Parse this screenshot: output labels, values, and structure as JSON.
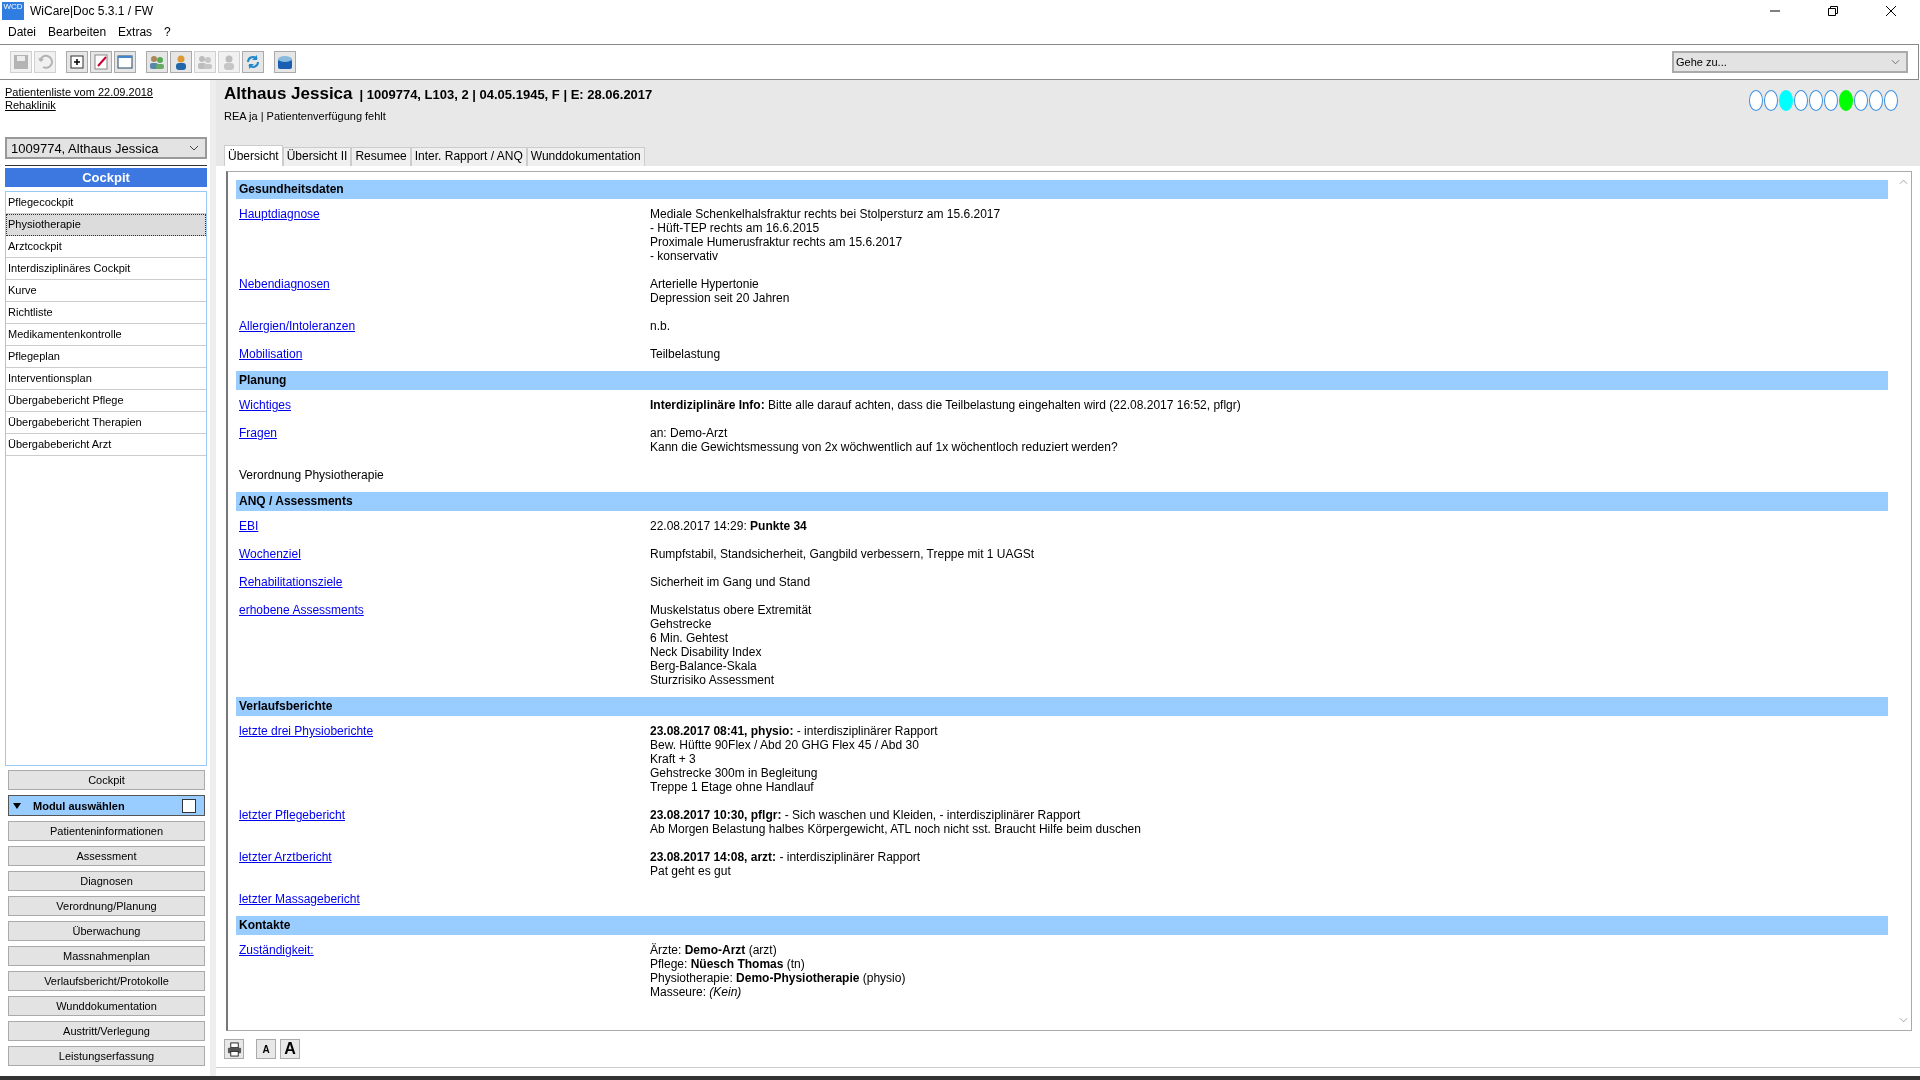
{
  "window": {
    "title": "WiCare|Doc 5.3.1  / FW",
    "logo_text": "WCD"
  },
  "menu": [
    "Datei",
    "Bearbeiten",
    "Extras",
    "?"
  ],
  "toolbar": [
    {
      "kind": "save",
      "disabled": true
    },
    {
      "kind": "undo",
      "disabled": true
    },
    {
      "kind": "sep"
    },
    {
      "kind": "add",
      "disabled": false
    },
    {
      "kind": "edit",
      "disabled": false
    },
    {
      "kind": "window",
      "disabled": false
    },
    {
      "kind": "sep"
    },
    {
      "kind": "group",
      "disabled": false
    },
    {
      "kind": "person",
      "disabled": false
    },
    {
      "kind": "group",
      "disabled": true
    },
    {
      "kind": "person",
      "disabled": true
    },
    {
      "kind": "refresh",
      "disabled": false
    },
    {
      "kind": "sep"
    },
    {
      "kind": "box",
      "disabled": false
    }
  ],
  "goto": {
    "value": "Gehe zu..."
  },
  "sidebar": {
    "patient_list_link": "Patientenliste vom 22.09.2018",
    "clinic_link": "Rehaklinik",
    "patient_select": "1009774, Althaus Jessica",
    "cockpit_title": "Cockpit",
    "items": [
      {
        "label": "Pflegecockpit",
        "selected": false
      },
      {
        "label": "Physiotherapie",
        "selected": true
      },
      {
        "label": "Arztcockpit",
        "selected": false
      },
      {
        "label": "Interdisziplinäres Cockpit",
        "selected": false
      },
      {
        "label": "Kurve",
        "selected": false
      },
      {
        "label": "Richtliste",
        "selected": false
      },
      {
        "label": "Medikamentenkontrolle",
        "selected": false
      },
      {
        "label": "Pflegeplan",
        "selected": false
      },
      {
        "label": "Interventionsplan",
        "selected": false
      },
      {
        "label": "Übergabebericht Pflege",
        "selected": false
      },
      {
        "label": "Übergabebericht Therapien",
        "selected": false
      },
      {
        "label": "Übergabebericht Arzt",
        "selected": false
      }
    ],
    "cockpit_button": "Cockpit",
    "module_header": {
      "label": "Modul auswählen",
      "expanded": true,
      "checked": false
    },
    "modules": [
      "Patienteninformationen",
      "Assessment",
      "Diagnosen",
      "Verordnung/Planung",
      "Überwachung",
      "Massnahmenplan",
      "Verlaufsbericht/Protokolle",
      "Wunddokumentation",
      "Austritt/Verlegung",
      "Leistungserfassung"
    ]
  },
  "patient": {
    "name": "Althaus Jessica",
    "details": "| 1009774, L103, 2 | 04.05.1945, F | E: 28.06.2017",
    "subline": "REA ja | Patientenverfügung fehlt",
    "status_dots": [
      {
        "color": "#ffffff"
      },
      {
        "color": "#ffffff"
      },
      {
        "color": "#00ffff"
      },
      {
        "color": "#ffffff"
      },
      {
        "color": "#ffffff"
      },
      {
        "color": "#ffffff"
      },
      {
        "color": "#00ff00"
      },
      {
        "color": "#ffffff"
      },
      {
        "color": "#ffffff"
      },
      {
        "color": "#ffffff"
      }
    ]
  },
  "tabs": [
    {
      "label": "Übersicht",
      "selected": true
    },
    {
      "label": "Übersicht II",
      "selected": false
    },
    {
      "label": "Resumee",
      "selected": false
    },
    {
      "label": "Inter. Rapport / ANQ",
      "selected": false
    },
    {
      "label": "Wunddokumentation",
      "selected": false
    }
  ],
  "sections": [
    {
      "title": "Gesundheitsdaten",
      "rows": [
        {
          "kind": "link",
          "label": "Hauptdiagnose",
          "lines": [
            "Mediale Schenkelhalsfraktur rechts bei Stolpersturz am 15.6.2017",
            "- Hüft-TEP rechts am 16.6.2015",
            "Proximale Humerusfraktur rechts am 15.6.2017",
            "- konservativ"
          ]
        },
        {
          "kind": "link",
          "label": "Nebendiagnosen",
          "lines": [
            "Arterielle Hypertonie",
            "Depression seit 20 Jahren"
          ]
        },
        {
          "kind": "link",
          "label": "Allergien/Intoleranzen",
          "lines": [
            "n.b."
          ]
        },
        {
          "kind": "link",
          "label": "Mobilisation",
          "lines": [
            "Teilbelastung"
          ]
        }
      ]
    },
    {
      "title": "Planung",
      "rows": [
        {
          "kind": "link",
          "label": "Wichtiges",
          "lines": [
            "**Interdiziplinäre Info:** Bitte alle darauf achten, dass die Teilbelastung eingehalten wird (22.08.2017 16:52, pflgr)"
          ]
        },
        {
          "kind": "link",
          "label": "Fragen",
          "lines": [
            "an: Demo-Arzt",
            "Kann die Gewichtsmessung von 2x wöchwentlich auf 1x wöchentloch reduziert werden?"
          ]
        },
        {
          "kind": "plain",
          "label": "Verordnung Physiotherapie",
          "lines": []
        }
      ]
    },
    {
      "title": "ANQ / Assessments",
      "rows": [
        {
          "kind": "link",
          "label": "EBI",
          "lines": [
            "22.08.2017 14:29: **Punkte 34**"
          ]
        },
        {
          "kind": "link",
          "label": "Wochenziel",
          "lines": [
            "Rumpfstabil, Standsicherheit, Gangbild verbessern, Treppe mit 1 UAGSt"
          ]
        },
        {
          "kind": "link",
          "label": "Rehabilitationsziele",
          "lines": [
            "Sicherheit im Gang und Stand"
          ]
        },
        {
          "kind": "link",
          "label": "erhobene Assessments",
          "lines": [
            "Muskelstatus obere Extremität",
            "Gehstrecke",
            "6 Min. Gehtest",
            "Neck Disability Index",
            "Berg-Balance-Skala",
            "Sturzrisiko Assessment"
          ]
        }
      ]
    },
    {
      "title": "Verlaufsberichte",
      "rows": [
        {
          "kind": "link",
          "label": "letzte drei Physioberichte",
          "lines": [
            "**23.08.2017 08:41, physio:** - interdisziplinärer Rapport",
            "Bew. Hüftte 90Flex / Abd 20 GHG Flex 45 / Abd 30",
            "Kraft + 3",
            "Gehstrecke 300m in Begleitung",
            "Treppe 1 Etage ohne Handlauf"
          ]
        },
        {
          "kind": "link",
          "label": "letzter Pflegebericht",
          "lines": [
            "**23.08.2017 10:30, pflgr:** - Sich waschen und Kleiden, - interdisziplinärer Rapport",
            "Ab Morgen Belastung halbes Körpergewicht, ATL noch nicht sst. Braucht Hilfe beim duschen"
          ]
        },
        {
          "kind": "link",
          "label": "letzter Arztbericht",
          "lines": [
            "**23.08.2017 14:08, arzt:** - interdisziplinärer Rapport",
            "Pat geht es gut"
          ]
        },
        {
          "kind": "link",
          "label": "letzter Massagebericht",
          "lines": []
        }
      ]
    },
    {
      "title": "Kontakte",
      "rows": [
        {
          "kind": "link",
          "label": "Zuständigkeit:",
          "lines": [
            "Ärzte: **Demo-Arzt** (arzt)",
            "Pflege: **Nüesch Thomas** (tn)",
            "Physiotherapie: **Demo-Physiotherapie** (physio)",
            "Masseure: *(Kein)*"
          ]
        }
      ]
    }
  ],
  "footer": {
    "font_small": "A",
    "font_large": "A"
  }
}
